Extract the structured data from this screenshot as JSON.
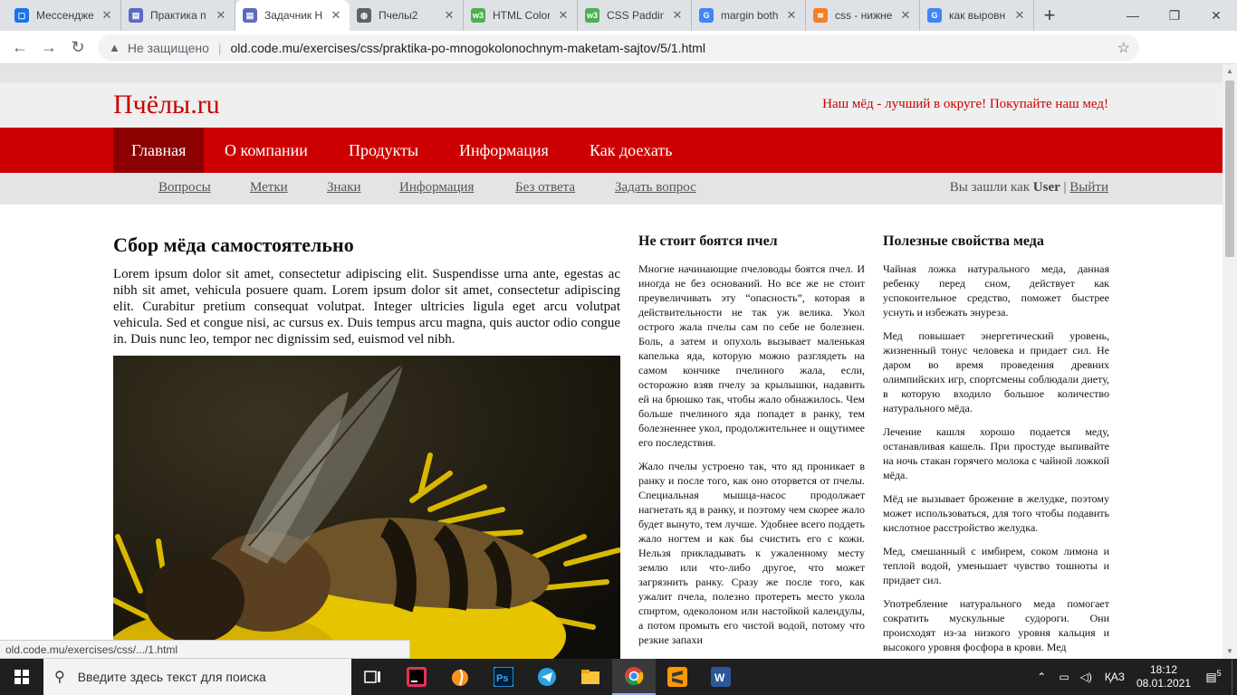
{
  "browser": {
    "tabs": [
      {
        "title": "Мессендже",
        "color": "#1a73e8",
        "glyph": "▢"
      },
      {
        "title": "Практика п",
        "color": "#5c6bc0",
        "glyph": "▤"
      },
      {
        "title": "Задачник H",
        "color": "#5c6bc0",
        "glyph": "▤"
      },
      {
        "title": "Пчелы2",
        "color": "#5f6368",
        "glyph": "◍"
      },
      {
        "title": "HTML Color",
        "color": "#4caf50",
        "glyph": "w3"
      },
      {
        "title": "CSS Padding",
        "color": "#4caf50",
        "glyph": "w3"
      },
      {
        "title": "margin both",
        "color": "#4285f4",
        "glyph": "G"
      },
      {
        "title": "css - нижне",
        "color": "#f48024",
        "glyph": "≋"
      },
      {
        "title": "как выровн",
        "color": "#4285f4",
        "glyph": "G"
      }
    ],
    "security_label": "Не защищено",
    "url": "old.code.mu/exercises/css/praktika-po-mnogokolonochnym-maketam-sajtov/5/1.html",
    "status_url": "old.code.mu/exercises/css/.../1.html"
  },
  "site": {
    "logo": "Пчёлы.ru",
    "slogan": "Наш мёд - лучший в округе! Покупайте наш мед!",
    "main_nav": [
      "Главная",
      "О компании",
      "Продукты",
      "Информация",
      "Как доехать"
    ],
    "sub_nav": [
      "Вопросы",
      "Метки",
      "Знаки",
      "Информация",
      "Без ответа",
      "Задать вопрос"
    ],
    "user": {
      "prefix": "Вы зашли как",
      "name": "User",
      "divider": "|",
      "logout": "Выйти"
    }
  },
  "article": {
    "title": "Сбор мёда самостоятельно",
    "body": "Lorem ipsum dolor sit amet, consectetur adipiscing elit. Suspendisse urna ante, egestas ac nibh sit amet, vehicula posuere quam. Lorem ipsum dolor sit amet, consectetur adipiscing elit. Curabitur pretium consequat volutpat. Integer ultricies ligula eget arcu volutpat vehicula. Sed et congue nisi, ac cursus ex. Duis tempus arcu magna, quis auctor odio congue in. Duis nunc leo, tempor nec dignissim sed, euismod vel nibh."
  },
  "sidebar1": {
    "title": "Не стоит боятся пчел",
    "paragraphs": [
      "Многие начинающие пчеловоды боятся пчел. И иногда не без оснований. Но все же не стоит преувеличивать эту “опасность”, которая в действительности не так уж велика. Укол острого жала пчелы сам по себе не болезнен. Боль, а затем и опухоль вызывает маленькая капелька яда, которую можно разглядеть на самом кончике пчелиного жала, если, осторожно взяв пчелу за крылышки, надавить ей на брюшко так, чтобы жало обнажилось. Чем больше пчелиного яда попадет в ранку, тем болезненнее укол, продолжительнее и ощутимее его последствия.",
      "Жало пчелы устроено так, что яд проникает в ранку и после того, как оно оторвется от пчелы. Специальная мышца-насос продолжает нагнетать яд в ранку, и поэтому чем скорее жало будет вынуто, тем лучше. Удобнее всего поддеть жало ногтем и как бы счистить его с кожи. Нельзя прикладывать к ужаленному месту землю или что-либо другое, что может загрязнить ранку. Сразу же после того, как ужалит пчела, полезно протереть место укола спиртом, одеколоном или настойкой календулы, а потом промыть его чистой водой, потому что резкие запахи"
    ]
  },
  "sidebar2": {
    "title": "Полезные свойства меда",
    "paragraphs": [
      "Чайная ложка натурального меда, данная ребенку перед сном, действует как успокоительное средство, поможет быстрее уснуть и избежать энуреза.",
      "Мед повышает энергетический уровень, жизненный тонус человека и придает сил. Не даром во время проведения древних олимпийских игр, спортсмены соблюдали диету, в которую входило большое количество натурального мёда.",
      "Лечение кашля хорошо подается меду, останавливая кашель. При простуде выпивайте на ночь стакан горячего молока с чайной ложкой мёда.",
      "Мёд не вызывает брожение в желудке, поэтому может использоваться, для того чтобы подавить кислотное расстройство желудка.",
      "Мед, смешанный с имбирем, соком лимона и теплой водой, уменьшает чувство тошноты и придает сил.",
      "Употребление натурального меда помогает сократить мускульные судороги. Они происходят из-за низкого уровня кальция и высокого уровня фосфора в крови. Мед"
    ]
  },
  "taskbar": {
    "search_placeholder": "Введите здесь текст для поиска",
    "language": "ҚАЗ",
    "time": "18:12",
    "date": "08.01.2021",
    "notifications": "5"
  }
}
